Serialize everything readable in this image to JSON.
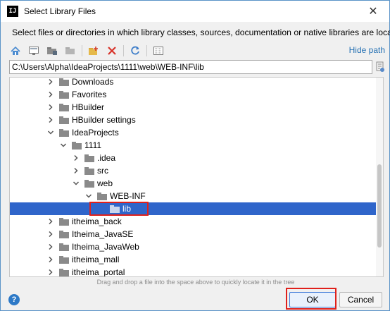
{
  "window": {
    "icon_text": "IJ",
    "title": "Select Library Files",
    "close_glyph": "✕"
  },
  "description": "Select files or directories in which library classes, sources, documentation or native libraries are located",
  "toolbar": {
    "buttons": [
      "home-icon",
      "desktop-icon",
      "project-icon",
      "module-icon",
      "new-folder-icon",
      "delete-icon",
      "refresh-icon",
      "show-hidden-icon"
    ],
    "hide_path_label": "Hide path"
  },
  "path": {
    "value": "C:\\Users\\Alpha\\IdeaProjects\\1111\\web\\WEB-INF\\lib"
  },
  "tree": {
    "items": [
      {
        "label": "Downloads",
        "expanded": false,
        "selected": false
      },
      {
        "label": "Favorites",
        "expanded": false,
        "selected": false
      },
      {
        "label": "HBuilder",
        "expanded": false,
        "selected": false
      },
      {
        "label": "HBuilder settings",
        "expanded": false,
        "selected": false
      },
      {
        "label": "IdeaProjects",
        "expanded": true,
        "selected": false
      },
      {
        "label": "1111",
        "expanded": true,
        "selected": false
      },
      {
        "label": ".idea",
        "expanded": false,
        "selected": false
      },
      {
        "label": "src",
        "expanded": false,
        "selected": false
      },
      {
        "label": "web",
        "expanded": true,
        "selected": false
      },
      {
        "label": "WEB-INF",
        "expanded": true,
        "selected": false
      },
      {
        "label": "lib",
        "expanded": false,
        "selected": true
      },
      {
        "label": "itheima_back",
        "expanded": false,
        "selected": false
      },
      {
        "label": "Itheima_JavaSE",
        "expanded": false,
        "selected": false
      },
      {
        "label": "Itheima_JavaWeb",
        "expanded": false,
        "selected": false
      },
      {
        "label": "itheima_mall",
        "expanded": false,
        "selected": false
      },
      {
        "label": "itheima_portal",
        "expanded": false,
        "selected": false
      }
    ]
  },
  "hint": "Drag and drop a file into the space above to quickly locate it in the tree",
  "footer": {
    "help_glyph": "?",
    "ok_label": "OK",
    "cancel_label": "Cancel"
  },
  "colors": {
    "selection": "#2f65ca",
    "link": "#2470b3",
    "highlight_box": "#e0201b"
  }
}
